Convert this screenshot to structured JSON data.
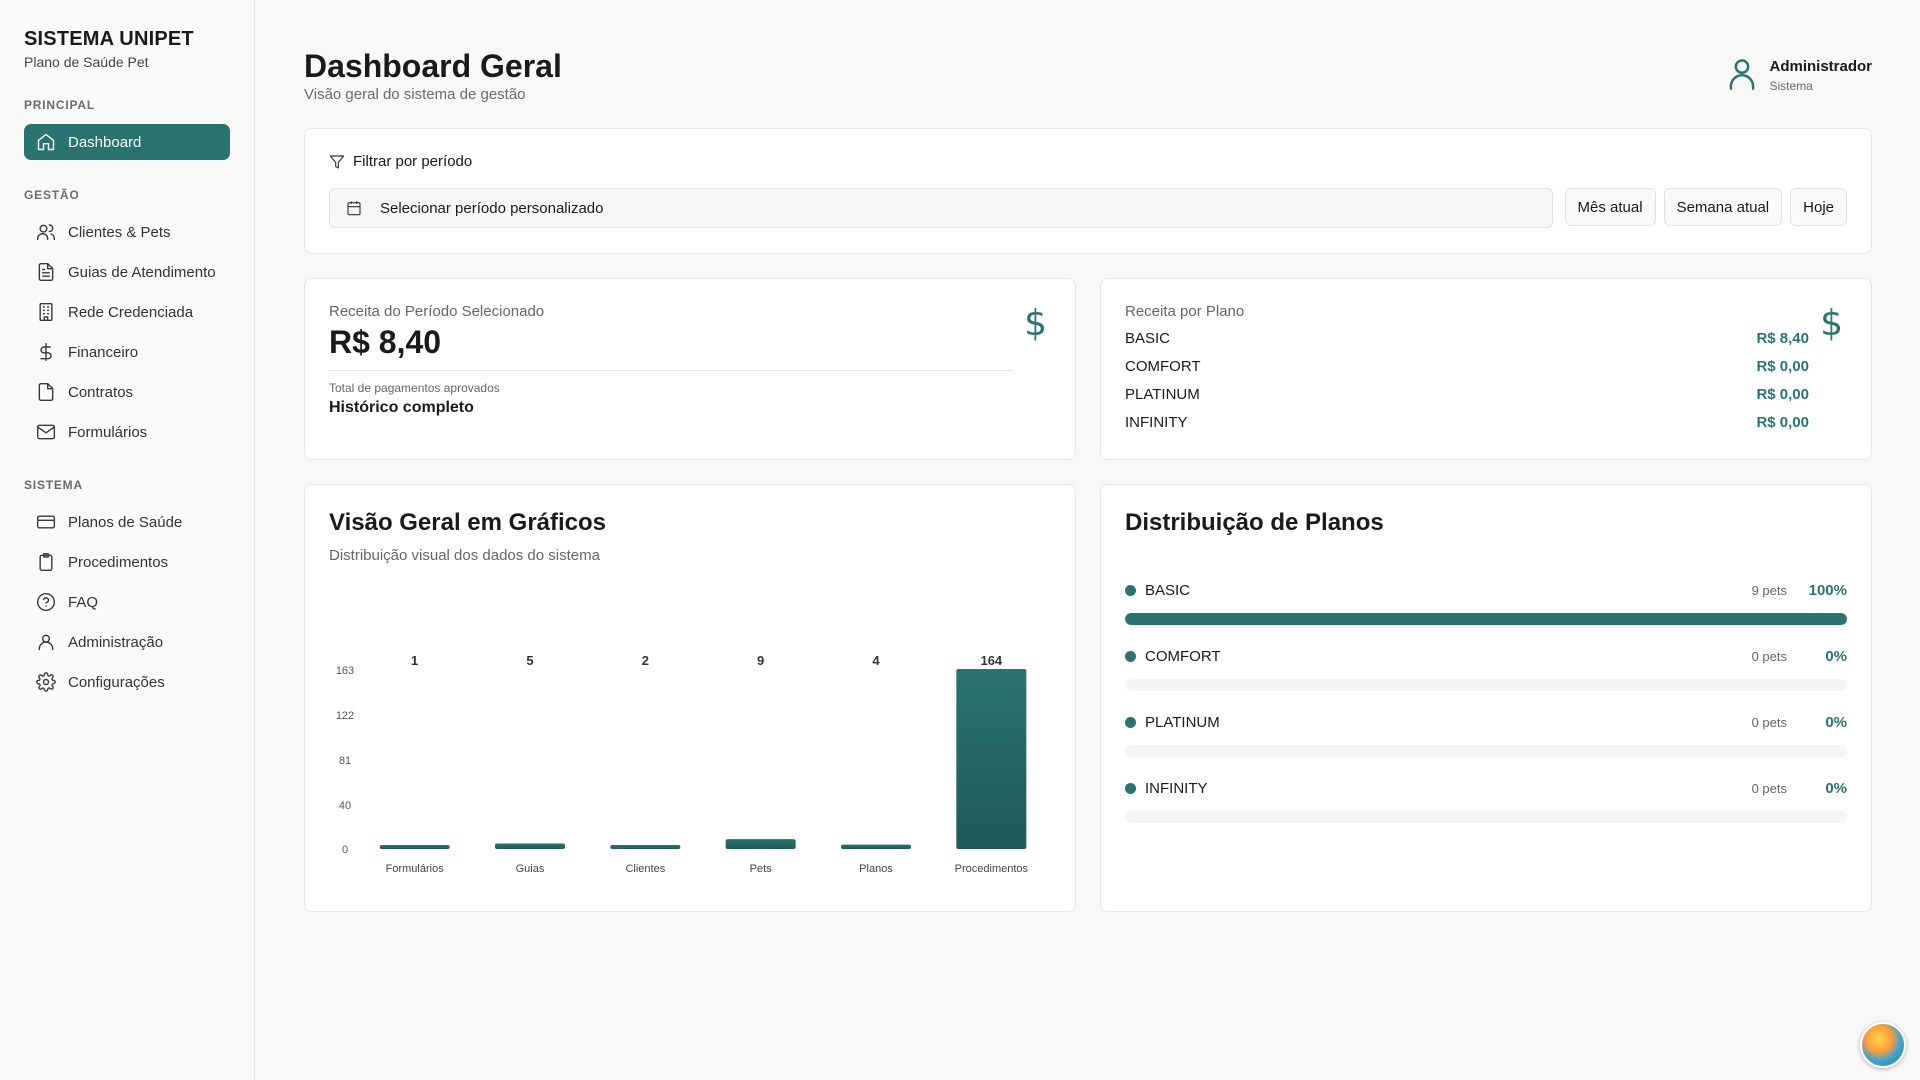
{
  "brand": {
    "title": "SISTEMA UNIPET",
    "subtitle": "Plano de Saúde Pet"
  },
  "sidebar": {
    "sections": [
      {
        "label": "PRINCIPAL",
        "items": [
          {
            "label": "Dashboard",
            "icon": "home-icon",
            "active": true
          }
        ]
      },
      {
        "label": "GESTÃO",
        "items": [
          {
            "label": "Clientes & Pets",
            "icon": "users-icon"
          },
          {
            "label": "Guias de Atendimento",
            "icon": "file-text-icon"
          },
          {
            "label": "Rede Credenciada",
            "icon": "building-icon"
          },
          {
            "label": "Financeiro",
            "icon": "dollar-icon"
          },
          {
            "label": "Contratos",
            "icon": "file-icon"
          },
          {
            "label": "Formulários",
            "icon": "mail-icon"
          }
        ]
      },
      {
        "label": "SISTEMA",
        "items": [
          {
            "label": "Planos de Saúde",
            "icon": "credit-card-icon"
          },
          {
            "label": "Procedimentos",
            "icon": "clipboard-icon"
          },
          {
            "label": "FAQ",
            "icon": "help-circle-icon"
          },
          {
            "label": "Administração",
            "icon": "user-icon"
          },
          {
            "label": "Configurações",
            "icon": "settings-icon"
          }
        ]
      }
    ]
  },
  "header": {
    "title": "Dashboard Geral",
    "subtitle": "Visão geral do sistema de gestão"
  },
  "user": {
    "name": "Administrador",
    "role": "Sistema"
  },
  "filter": {
    "title": "Filtrar por período",
    "date_placeholder": "Selecionar período personalizado",
    "buttons": [
      "Mês atual",
      "Semana atual",
      "Hoje"
    ]
  },
  "revenue": {
    "label": "Receita do Período Selecionado",
    "value": "R$ 8,40",
    "note": "Total de pagamentos aprovados",
    "period": "Histórico completo",
    "icon": "$"
  },
  "plan_revenue": {
    "label": "Receita por Plano",
    "icon": "$",
    "rows": [
      {
        "name": "BASIC",
        "value": "R$ 8,40"
      },
      {
        "name": "COMFORT",
        "value": "R$ 0,00"
      },
      {
        "name": "PLATINUM",
        "value": "R$ 0,00"
      },
      {
        "name": "INFINITY",
        "value": "R$ 0,00"
      }
    ]
  },
  "overview": {
    "title": "Visão Geral em Gráficos",
    "subtitle": "Distribuição visual dos dados do sistema"
  },
  "chart_data": {
    "type": "bar",
    "categories": [
      "Formulários",
      "Guias",
      "Clientes",
      "Pets",
      "Planos",
      "Procedimentos"
    ],
    "values": [
      1,
      5,
      2,
      9,
      4,
      164
    ],
    "data_labels": [
      "1",
      "5",
      "2",
      "9",
      "4",
      "164"
    ],
    "yticks": [
      0,
      40,
      81,
      122,
      163
    ],
    "ytick_labels": [
      "0",
      "40",
      "81",
      "122",
      "163"
    ],
    "ylim": [
      0,
      164
    ],
    "grid": false,
    "bar_color": "#2a7470"
  },
  "distribution": {
    "title": "Distribuição de Planos",
    "items": [
      {
        "name": "BASIC",
        "pets": "9 pets",
        "pct": "100%",
        "fraction": 1.0
      },
      {
        "name": "COMFORT",
        "pets": "0 pets",
        "pct": "0%",
        "fraction": 0
      },
      {
        "name": "PLATINUM",
        "pets": "0 pets",
        "pct": "0%",
        "fraction": 0
      },
      {
        "name": "INFINITY",
        "pets": "0 pets",
        "pct": "0%",
        "fraction": 0
      }
    ]
  },
  "colors": {
    "accent": "#2a7470"
  }
}
